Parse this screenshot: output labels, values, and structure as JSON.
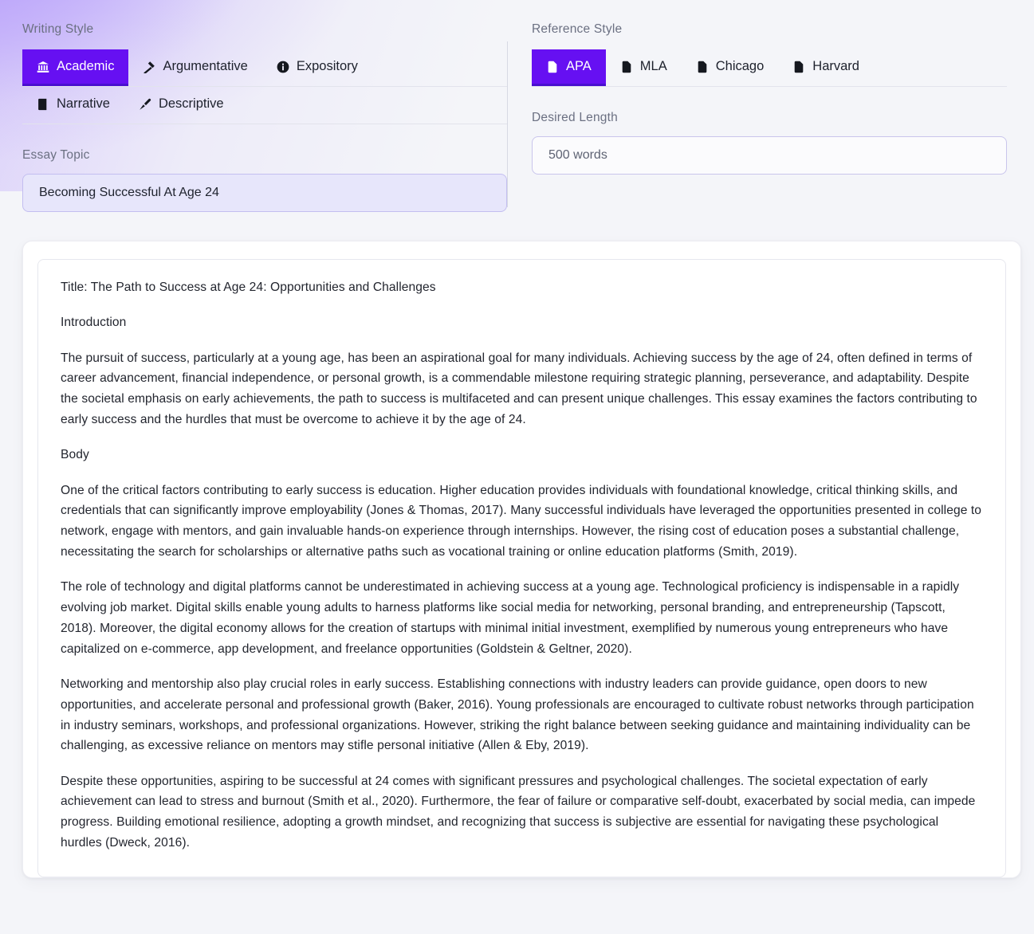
{
  "theme": {
    "accent": "#6610f2",
    "accent_dark": "#4a0fd0",
    "page_bg": "#f4f5f9",
    "input_filled_bg": "#e7e6fb",
    "input_border": "#c3bef0",
    "text": "#22252e",
    "label_text": "#6b7082"
  },
  "writing_style": {
    "label": "Writing Style",
    "selected": "Academic",
    "options": [
      {
        "label": "Academic",
        "icon": "bank-icon",
        "active": true
      },
      {
        "label": "Argumentative",
        "icon": "gavel-icon",
        "active": false
      },
      {
        "label": "Expository",
        "icon": "info-circle-icon",
        "active": false
      },
      {
        "label": "Narrative",
        "icon": "book-icon",
        "active": false
      },
      {
        "label": "Descriptive",
        "icon": "paintbrush-icon",
        "active": false
      }
    ]
  },
  "reference_style": {
    "label": "Reference Style",
    "selected": "APA",
    "options": [
      {
        "label": "APA",
        "icon": "document-lines-icon",
        "active": true
      },
      {
        "label": "MLA",
        "icon": "document-lines-icon",
        "active": false
      },
      {
        "label": "Chicago",
        "icon": "document-icon",
        "active": false
      },
      {
        "label": "Harvard",
        "icon": "document-icon",
        "active": false
      }
    ]
  },
  "essay_topic": {
    "label": "Essay Topic",
    "value": "Becoming Successful At Age 24",
    "placeholder": "Becoming Successful At Age 24"
  },
  "desired_length": {
    "label": "Desired Length",
    "value": "",
    "placeholder": "500 words"
  },
  "essay": {
    "paragraphs": [
      "Title: The Path to Success at Age 24: Opportunities and Challenges",
      "Introduction",
      "The pursuit of success, particularly at a young age, has been an aspirational goal for many individuals. Achieving success by the age of 24, often defined in terms of career advancement, financial independence, or personal growth, is a commendable milestone requiring strategic planning, perseverance, and adaptability. Despite the societal emphasis on early achievements, the path to success is multifaceted and can present unique challenges. This essay examines the factors contributing to early success and the hurdles that must be overcome to achieve it by the age of 24.",
      "Body",
      "One of the critical factors contributing to early success is education. Higher education provides individuals with foundational knowledge, critical thinking skills, and credentials that can significantly improve employability (Jones & Thomas, 2017). Many successful individuals have leveraged the opportunities presented in college to network, engage with mentors, and gain invaluable hands-on experience through internships. However, the rising cost of education poses a substantial challenge, necessitating the search for scholarships or alternative paths such as vocational training or online education platforms (Smith, 2019).",
      "The role of technology and digital platforms cannot be underestimated in achieving success at a young age. Technological proficiency is indispensable in a rapidly evolving job market. Digital skills enable young adults to harness platforms like social media for networking, personal branding, and entrepreneurship (Tapscott, 2018). Moreover, the digital economy allows for the creation of startups with minimal initial investment, exemplified by numerous young entrepreneurs who have capitalized on e-commerce, app development, and freelance opportunities (Goldstein & Geltner, 2020).",
      "Networking and mentorship also play crucial roles in early success. Establishing connections with industry leaders can provide guidance, open doors to new opportunities, and accelerate personal and professional growth (Baker, 2016). Young professionals are encouraged to cultivate robust networks through participation in industry seminars, workshops, and professional organizations. However, striking the right balance between seeking guidance and maintaining individuality can be challenging, as excessive reliance on mentors may stifle personal initiative (Allen & Eby, 2019).",
      "Despite these opportunities, aspiring to be successful at 24 comes with significant pressures and psychological challenges. The societal expectation of early achievement can lead to stress and burnout (Smith et al., 2020). Furthermore, the fear of failure or comparative self-doubt, exacerbated by social media, can impede progress. Building emotional resilience, adopting a growth mindset, and recognizing that success is subjective are essential for navigating these psychological hurdles (Dweck, 2016)."
    ]
  }
}
